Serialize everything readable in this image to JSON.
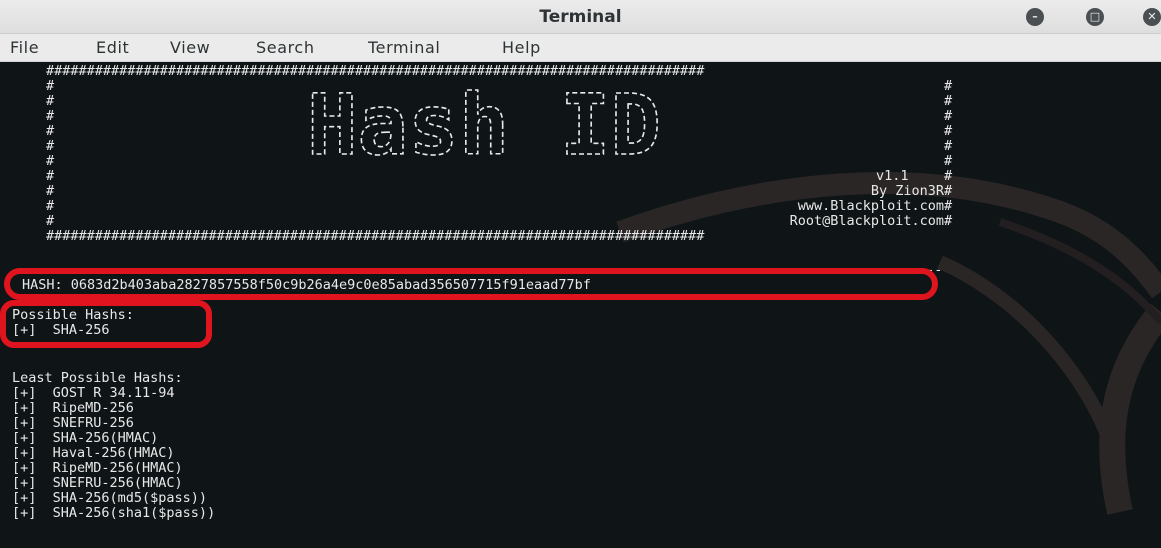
{
  "window": {
    "title": "Terminal",
    "minimize_icon": "minimize-icon",
    "maximize_icon": "maximize-icon",
    "close_icon": "close-icon"
  },
  "menu": [
    "File",
    "Edit",
    "View",
    "Search",
    "Terminal",
    "Help"
  ],
  "banner": {
    "border": "#################################################################################",
    "side": "#",
    "logo": "Hash ID",
    "version": "v1.1",
    "author": "By Zion3R",
    "site": "www.Blackploit.com",
    "email": "Root@Blackploit.com"
  },
  "output": {
    "dashes": "---",
    "hash_line": "HASH: 0683d2b403aba2827857558f50c9b26a4e9c0e85abad356507715f91eaad77bf",
    "possible_header": "Possible Hashs:",
    "possible": [
      "[+]  SHA-256"
    ],
    "least_header": "Least Possible Hashs:",
    "least": [
      "[+]  GOST R 34.11-94",
      "[+]  RipeMD-256",
      "[+]  SNEFRU-256",
      "[+]  SHA-256(HMAC)",
      "[+]  Haval-256(HMAC)",
      "[+]  RipeMD-256(HMAC)",
      "[+]  SNEFRU-256(HMAC)",
      "[+]  SHA-256(md5($pass))",
      "[+]  SHA-256(sha1($pass))"
    ]
  },
  "colors": {
    "terminal_bg": "#0f1416",
    "text": "#e8e8e8",
    "annotation": "#e0141e"
  }
}
